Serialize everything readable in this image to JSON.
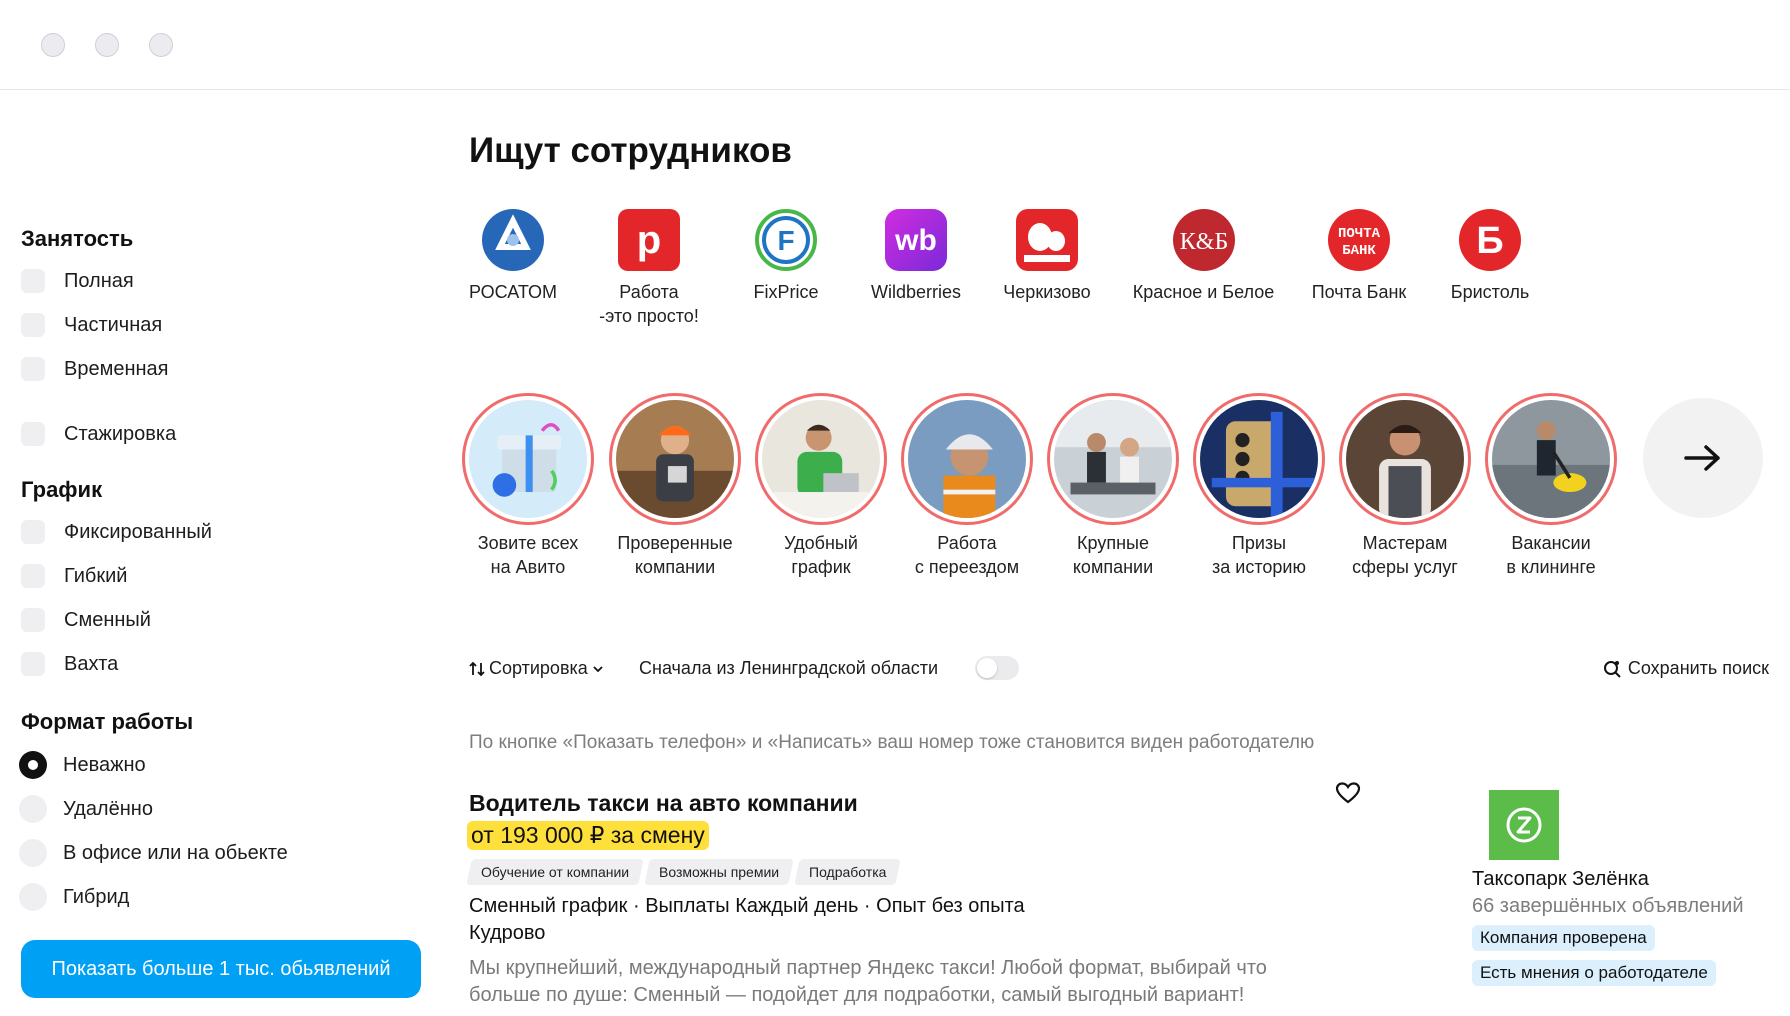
{
  "page": {
    "title": "Ищут сотрудников"
  },
  "filters": {
    "employment": {
      "title": "Занятость",
      "items": [
        "Полная",
        "Частичная",
        "Временная",
        "Стажировка"
      ]
    },
    "schedule": {
      "title": "График",
      "items": [
        "Фиксированный",
        "Гибкий",
        "Сменный",
        "Вахта"
      ]
    },
    "work_format": {
      "title": "Формат работы",
      "items": [
        "Неважно",
        "Удалённо",
        "В офисе или на обьекте",
        "Гибрид"
      ],
      "selected": "Неважно"
    },
    "show_more_label": "Показать больше 1 тыс. обьявлений"
  },
  "brands": [
    {
      "name": "РОСАТОМ",
      "icon": "rosatom-logo",
      "color": "#2767b8"
    },
    {
      "name": "Работа\n-это просто!",
      "icon": "rabota-logo",
      "color": "#e3262a"
    },
    {
      "name": "FixPrice",
      "icon": "fixprice-logo",
      "color": "#1f74c4"
    },
    {
      "name": "Wildberries",
      "icon": "wildberries-logo",
      "color": "#b12bd8"
    },
    {
      "name": "Черкизово",
      "icon": "cherkizovo-logo",
      "color": "#e3262a"
    },
    {
      "name": "Красное и Белое",
      "icon": "kb-logo",
      "color": "#c0282f"
    },
    {
      "name": "Почта Банк",
      "icon": "pochtabank-logo",
      "color": "#e3262a"
    },
    {
      "name": "Бристоль",
      "icon": "bristol-logo",
      "color": "#e3262a"
    }
  ],
  "stories": [
    {
      "caption": "Зовите всех\nна Авито",
      "icon": "gift-image"
    },
    {
      "caption": "Проверенные\nкомпании",
      "icon": "worker-image"
    },
    {
      "caption": "Удобный\nграфик",
      "icon": "laptop-image"
    },
    {
      "caption": "Работа\nс переездом",
      "icon": "builder-image"
    },
    {
      "caption": "Крупные\nкомпании",
      "icon": "office-image"
    },
    {
      "caption": "Призы\nза историю",
      "icon": "phone-image"
    },
    {
      "caption": "Мастерам\nсферы услуг",
      "icon": "master-image"
    },
    {
      "caption": "Вакансии\nв клининге",
      "icon": "cleaning-image"
    }
  ],
  "sortbar": {
    "sort_label": "Сортировка",
    "region_label": "Сначала из Ленинградской области",
    "region_toggle_on": false,
    "save_search_label": "Сохранить поиск"
  },
  "notice": "По кнопке «Показать телефон» и «Написать» ваш номер тоже становится виден работодателю",
  "listing": {
    "title": "Водитель такси на авто компании",
    "salary": "от 193 000 ₽ за смену",
    "tags": [
      "Обучение от компании",
      "Возможны премии",
      "Подработка"
    ],
    "params": "Сменный график · Выплаты Каждый день · Опыт без опыта",
    "location": "Кудрово",
    "description": "Мы крупнейший, международный партнер Яндекс такси! Любой формат, выбирай что больше по душе: Сменный — подойдет для подработки, самый выгодный вариант!",
    "company": {
      "name": "Таксопарк Зелёнка",
      "count": "66 завершённых объявлений",
      "badges": [
        "Компания проверена",
        "Есть мнения о работодателе"
      ],
      "logo_color": "#5cbc4a"
    }
  },
  "colors": {
    "accent": "#00a0f5",
    "salary_highlight": "#ffe03a",
    "story_ring": "#f06b6b"
  }
}
